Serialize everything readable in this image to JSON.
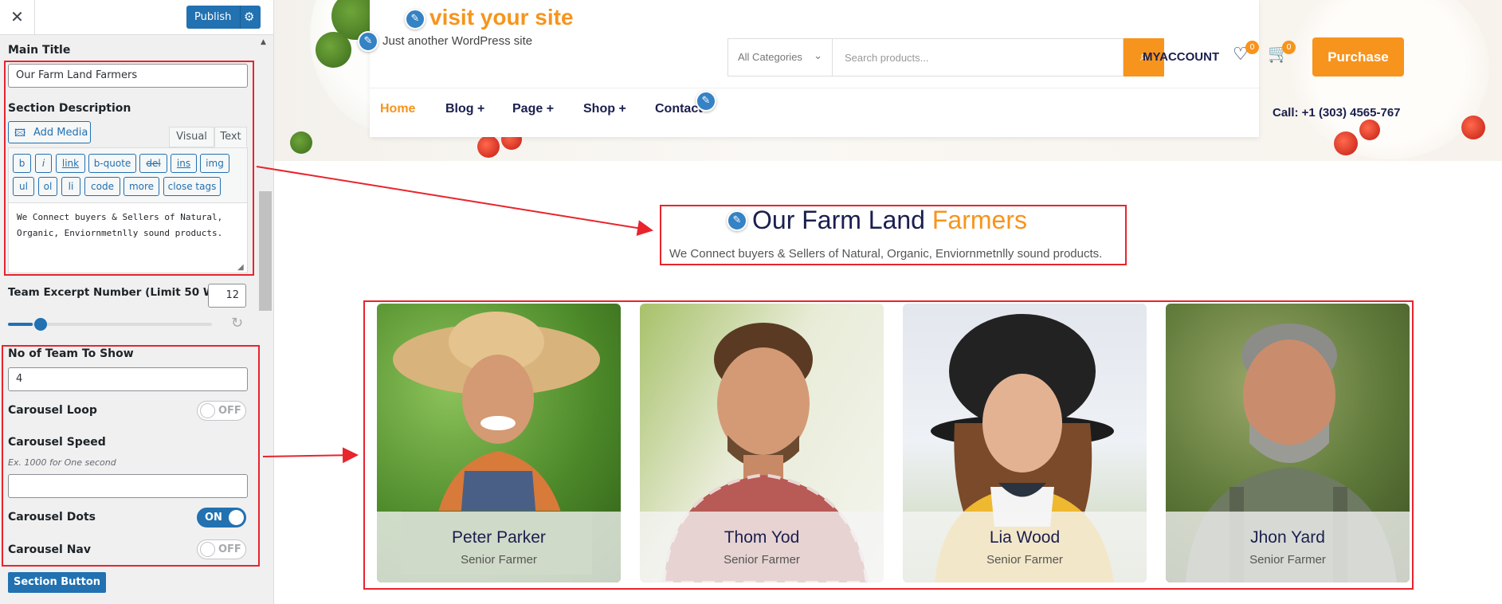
{
  "customizer": {
    "close_glyph": "✕",
    "publish_label": "Publish",
    "main_title": {
      "label": "Main Title",
      "value": "Our Farm Land Farmers"
    },
    "section_description": {
      "label": "Section Description",
      "add_media_label": "Add Media",
      "tabs": [
        "Visual",
        "Text"
      ],
      "active_tab": "Text",
      "quicktags": [
        "b",
        "i",
        "link",
        "b-quote",
        "del",
        "ins",
        "img",
        "ul",
        "ol",
        "li",
        "code",
        "more",
        "close tags"
      ],
      "value": "We Connect buyers & Sellers of Natural, Organic, Enviornmetnlly sound products."
    },
    "team_excerpt": {
      "label": "Team Excerpt Number (Limit 50 Words)",
      "value": "12",
      "slider_fraction": 0.12
    },
    "team_count": {
      "label": "No of Team To Show",
      "value": "4"
    },
    "carousel_loop": {
      "label": "Carousel Loop",
      "state": "OFF"
    },
    "carousel_speed": {
      "label": "Carousel Speed",
      "hint": "Ex. 1000 for One second",
      "value": ""
    },
    "carousel_dots": {
      "label": "Carousel Dots",
      "state": "ON"
    },
    "carousel_nav": {
      "label": "Carousel Nav",
      "state": "OFF"
    },
    "section_button_label": "Section Button"
  },
  "site": {
    "title": "visit your site",
    "tagline": "Just another WordPress site",
    "search": {
      "category": "All Categories",
      "placeholder": "Search products..."
    },
    "account_label": "MYACCOUNT",
    "wishlist_count": "0",
    "cart_count": "0",
    "purchase_label": "Purchase",
    "nav": [
      {
        "label": "Home",
        "active": true
      },
      {
        "label": "Blog +",
        "active": false
      },
      {
        "label": "Page +",
        "active": false
      },
      {
        "label": "Shop +",
        "active": false
      },
      {
        "label": "Contact",
        "active": false
      }
    ],
    "call": "Call: +1 (303) 4565-767"
  },
  "section": {
    "title_main": "Our Farm Land ",
    "title_accent": "Farmers",
    "description": "We Connect buyers & Sellers of Natural, Organic, Enviornmetnlly sound products."
  },
  "team": [
    {
      "name": "Peter Parker",
      "role": "Senior Farmer"
    },
    {
      "name": "Thom Yod",
      "role": "Senior Farmer"
    },
    {
      "name": "Lia Wood",
      "role": "Senior Farmer"
    },
    {
      "name": "Jhon Yard",
      "role": "Senior Farmer"
    }
  ],
  "colors": {
    "accent": "#f7941d",
    "navy": "#1a1f4e",
    "wp_blue": "#2271b1",
    "highlight_red": "#e8242c"
  }
}
